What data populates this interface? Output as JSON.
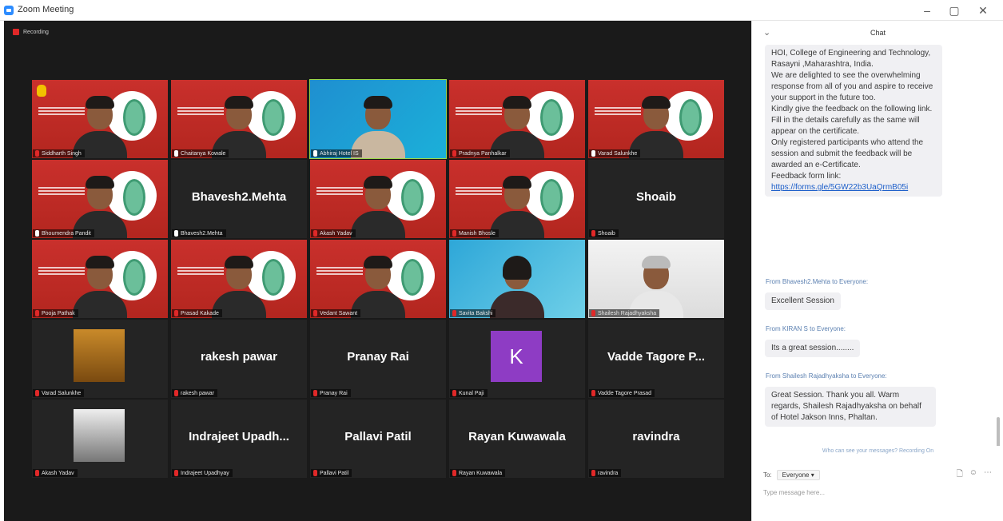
{
  "window": {
    "title": "Zoom Meeting",
    "minimize": "–",
    "maximize": "▢",
    "close": "✕"
  },
  "recording": {
    "label": "Recording"
  },
  "participants": [
    {
      "name": "Siddharth Singh",
      "bg": "red",
      "muted": true,
      "hand": true
    },
    {
      "name": "Chaitanya Kowale",
      "bg": "red",
      "muted": false
    },
    {
      "name": "Abhiraj Hotel IS",
      "bg": "blue",
      "muted": false,
      "active": true
    },
    {
      "name": "Pradnya Panhalkar",
      "bg": "red",
      "muted": true
    },
    {
      "name": "Varad Salunkhe",
      "bg": "red",
      "muted": false
    },
    {
      "name": "Bhoumendra Pandit",
      "bg": "red",
      "muted": false
    },
    {
      "name": "Bhavesh2.Mehta",
      "big": "Bhavesh2.Mehta",
      "muted": false
    },
    {
      "name": "Akash Yadav",
      "bg": "red",
      "muted": true
    },
    {
      "name": "Manish Bhosle",
      "bg": "red",
      "muted": true
    },
    {
      "name": "Shoaib",
      "big": "Shoaib",
      "muted": true
    },
    {
      "name": "Pooja Pathak",
      "bg": "red",
      "muted": true
    },
    {
      "name": "Prasad Kakade",
      "bg": "red",
      "muted": true
    },
    {
      "name": "Vedant Sawant",
      "bg": "red",
      "muted": true
    },
    {
      "name": "Savita Bakshi",
      "bg": "lightblue",
      "muted": true
    },
    {
      "name": "Shailesh Rajadhyaksha",
      "bg": "white",
      "muted": true
    },
    {
      "name": "Varad Salunkhe",
      "photo": "gold",
      "muted": true
    },
    {
      "name": "rakesh pawar",
      "big": "rakesh pawar",
      "muted": true
    },
    {
      "name": "Pranay Rai",
      "big": "Pranay Rai",
      "muted": true
    },
    {
      "name": "Kunal Paji",
      "avatar": "K",
      "muted": true
    },
    {
      "name": "Vadde Tagore Prasad",
      "big": "Vadde Tagore P...",
      "muted": true
    },
    {
      "name": "Akash Yadav",
      "photo": "bw",
      "muted": true
    },
    {
      "name": "Indrajeet Upadhyay",
      "big": "Indrajeet Upadh...",
      "muted": true
    },
    {
      "name": "Pallavi Patil",
      "big": "Pallavi Patil",
      "muted": true
    },
    {
      "name": "Rayan Kuwawala",
      "big": "Rayan Kuwawala",
      "muted": true
    },
    {
      "name": "ravindra",
      "big": "ravindra",
      "muted": true
    }
  ],
  "chat": {
    "title": "Chat",
    "messages": [
      {
        "text": "HOI, College of Engineering and Technology, Rasayni ,Maharashtra, India.\nWe are delighted to see the overwhelming response from all of you and aspire to receive your support in the future too.\nKindly give the feedback on the following link. Fill in the details carefully as the same will appear on the certificate.\nOnly registered participants who attend the session and submit the feedback will be awarded an e-Certificate.\nFeedback form link:",
        "link": "https://forms.gle/5GW22b3UaQrmB05i"
      },
      {
        "from": "From Bhavesh2.Mehta to Everyone:",
        "text": "Excellent Session"
      },
      {
        "from": "From KIRAN S to Everyone:",
        "text": "Its a great session........"
      },
      {
        "from": "From Shailesh Rajadhyaksha to Everyone:",
        "text": "Great Session. Thank you all. Warm regards, Shailesh Rajadhyaksha on behalf of Hotel Jakson Inns, Phaltan."
      }
    ],
    "privacy_notice": "Who can see your messages? Recording On",
    "to_label": "To:",
    "to_value": "Everyone",
    "input_placeholder": "Type message here..."
  },
  "colors": {
    "accent": "#2d8cff",
    "muted_mic": "#e02828",
    "active_speaker": "#9ad94a"
  }
}
